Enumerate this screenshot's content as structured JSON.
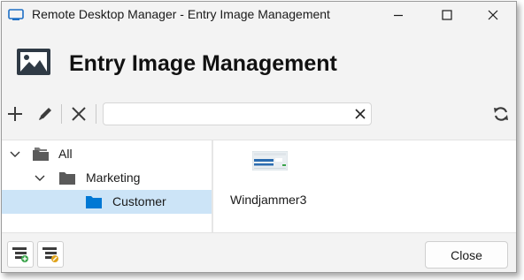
{
  "window": {
    "title": "Remote Desktop Manager - Entry Image Management",
    "controls": [
      "minimize-icon",
      "maximize-icon",
      "close-icon"
    ]
  },
  "header": {
    "title": "Entry Image Management",
    "icon": "image-icon"
  },
  "toolbar": {
    "buttons": [
      "plus-icon",
      "pencil-icon",
      "delete-x-icon"
    ],
    "search": {
      "value": "",
      "placeholder": ""
    },
    "refresh_icon": "refresh-icon"
  },
  "tree": {
    "items": [
      {
        "label": "All",
        "level": 0,
        "expanded": true,
        "icon": "folder-stack-icon"
      },
      {
        "label": "Marketing",
        "level": 1,
        "expanded": true,
        "icon": "folder-icon"
      },
      {
        "label": "Customer",
        "level": 2,
        "selected": true,
        "icon": "folder-icon"
      }
    ]
  },
  "images": [
    {
      "label": "Windjammer3",
      "icon": "image-thumbnail"
    }
  ],
  "footer": {
    "buttons": [
      "add-group-icon",
      "edit-group-icon"
    ],
    "close_label": "Close"
  },
  "colors": {
    "accent": "#0078d4",
    "selection": "#cce4f7",
    "folder_gray": "#5a5a5a"
  }
}
